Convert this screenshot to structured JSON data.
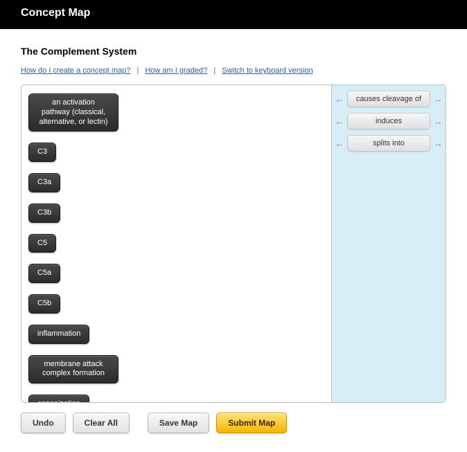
{
  "header": {
    "title": "Concept Map"
  },
  "page": {
    "subtitle": "The Complement System"
  },
  "help_links": {
    "create": "How do I create a concept map?",
    "graded": "How am I graded?",
    "keyboard": "Switch to keyboard version"
  },
  "nodes": {
    "activation": "an activation pathway (classical, alternative, or lectin)",
    "c3": "C3",
    "c3a": "C3a",
    "c3b": "C3b",
    "c5": "C5",
    "c5a": "C5a",
    "c5b": "C5b",
    "inflammation": "inflammation",
    "mac": "membrane attack complex formation",
    "opsonization": "opsonization"
  },
  "connectors": {
    "causes_cleavage_of": "causes cleavage of",
    "induces": "induces",
    "splits_into": "splits into"
  },
  "buttons": {
    "undo": "Undo",
    "clear_all": "Clear All",
    "save_map": "Save Map",
    "submit_map": "Submit Map"
  }
}
